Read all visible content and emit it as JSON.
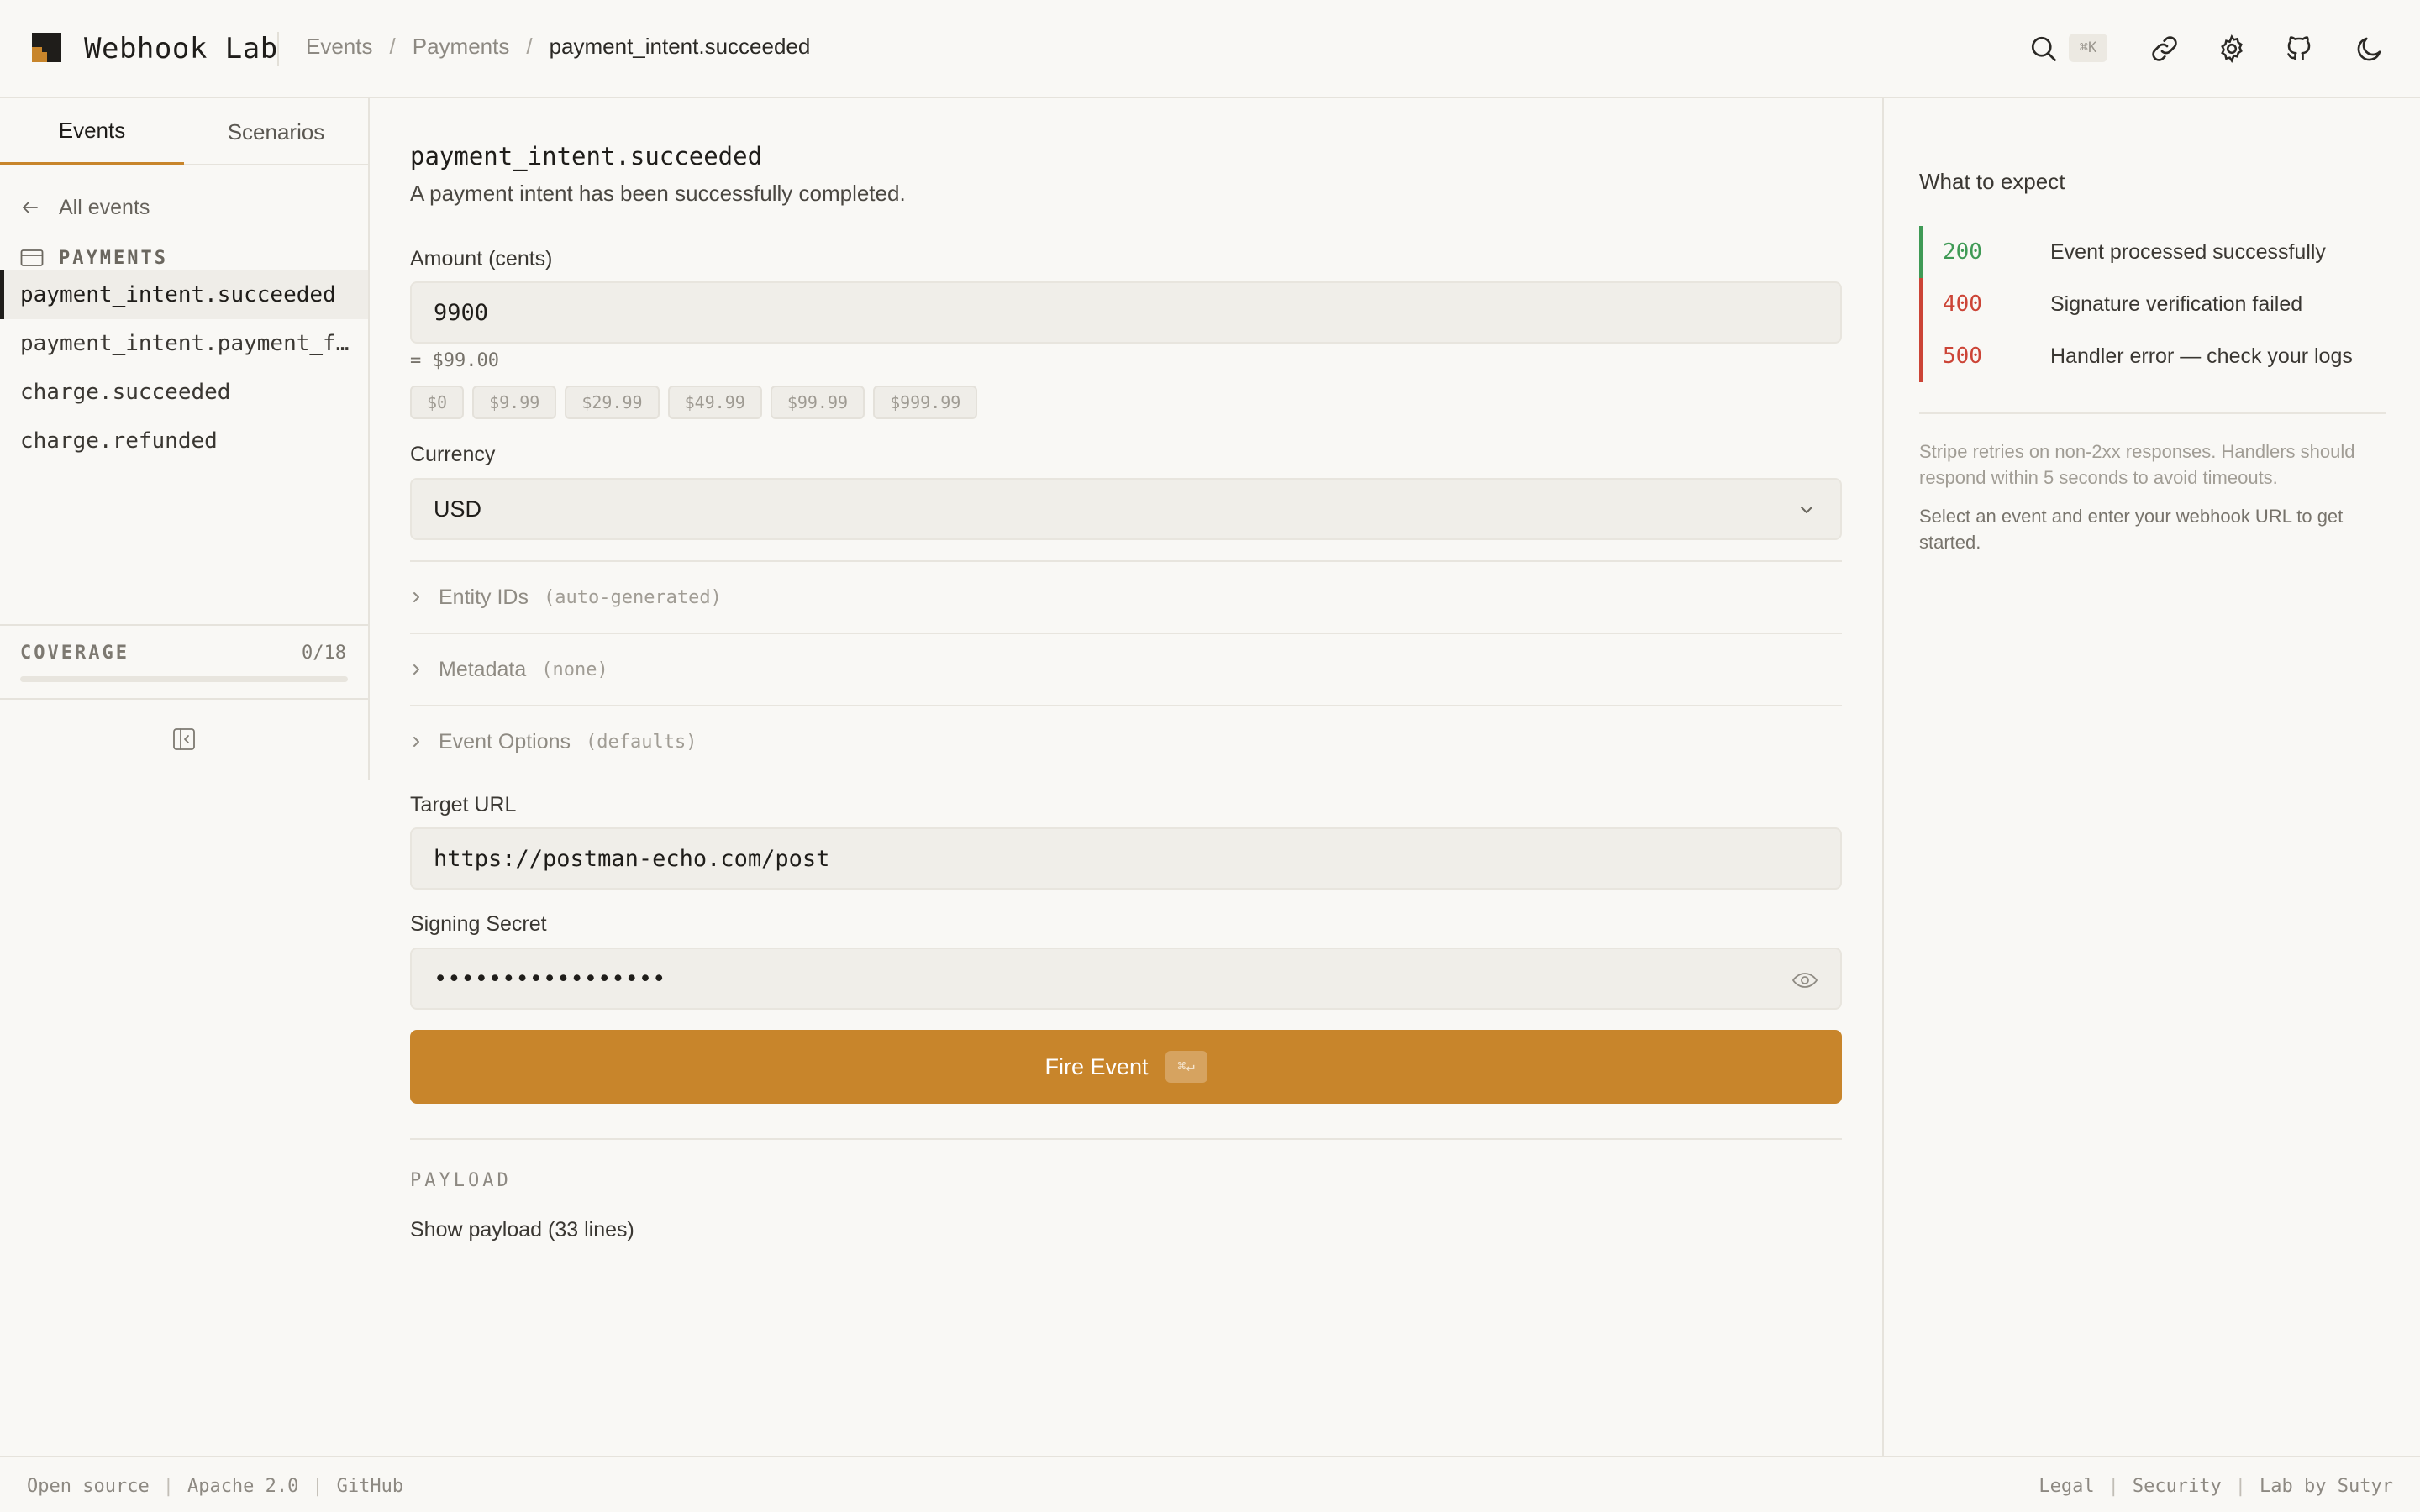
{
  "app": {
    "title": "Webhook Lab"
  },
  "breadcrumb": [
    "Events",
    "Payments",
    "payment_intent.succeeded"
  ],
  "header": {
    "search_shortcut": "⌘K"
  },
  "sidebar": {
    "tabs": [
      "Events",
      "Scenarios"
    ],
    "back_label": "All events",
    "group_label": "PAYMENTS",
    "events": [
      "payment_intent.succeeded",
      "payment_intent.payment_failed",
      "charge.succeeded",
      "charge.refunded"
    ],
    "coverage_label": "COVERAGE",
    "coverage_count": "0/18",
    "coverage_progress": 0
  },
  "event": {
    "name": "payment_intent.succeeded",
    "description": "A payment intent has been successfully completed."
  },
  "form": {
    "amount_label": "Amount (cents)",
    "amount_value": "9900",
    "amount_display": "= $99.00",
    "presets": [
      "$0",
      "$9.99",
      "$29.99",
      "$49.99",
      "$99.99",
      "$999.99"
    ],
    "currency_label": "Currency",
    "currency_value": "USD",
    "entity_ids_label": "Entity IDs",
    "entity_ids_hint": "(auto-generated)",
    "metadata_label": "Metadata",
    "metadata_hint": "(none)",
    "options_label": "Event Options",
    "options_hint": "(defaults)",
    "target_url_label": "Target URL",
    "target_url_value": "https://postman-echo.com/post",
    "secret_label": "Signing Secret",
    "secret_value": "•••••••••••••••••",
    "fire_label": "Fire Event",
    "fire_shortcut": "⌘↵"
  },
  "payload": {
    "header": "PAYLOAD",
    "toggle_label": "Show payload (33 lines)"
  },
  "expect": {
    "title": "What to expect",
    "statuses": [
      {
        "code": "200",
        "text": "Event processed successfully",
        "color": "#3f9a55"
      },
      {
        "code": "400",
        "text": "Signature verification failed",
        "color": "#cc4436"
      },
      {
        "code": "500",
        "text": "Handler error — check your logs",
        "color": "#cc4436"
      }
    ],
    "note_1": "Stripe retries on non-2xx responses. Handlers should respond within 5 seconds to avoid timeouts.",
    "note_2": "Select an event and enter your webhook URL to get started."
  },
  "footer": {
    "left": [
      "Open source",
      "Apache 2.0",
      "GitHub"
    ],
    "right": [
      "Legal",
      "Security",
      "Lab by Sutyr"
    ]
  },
  "colors": {
    "accent": "#c8852b",
    "success": "#3f9a55",
    "error": "#cc4436"
  }
}
